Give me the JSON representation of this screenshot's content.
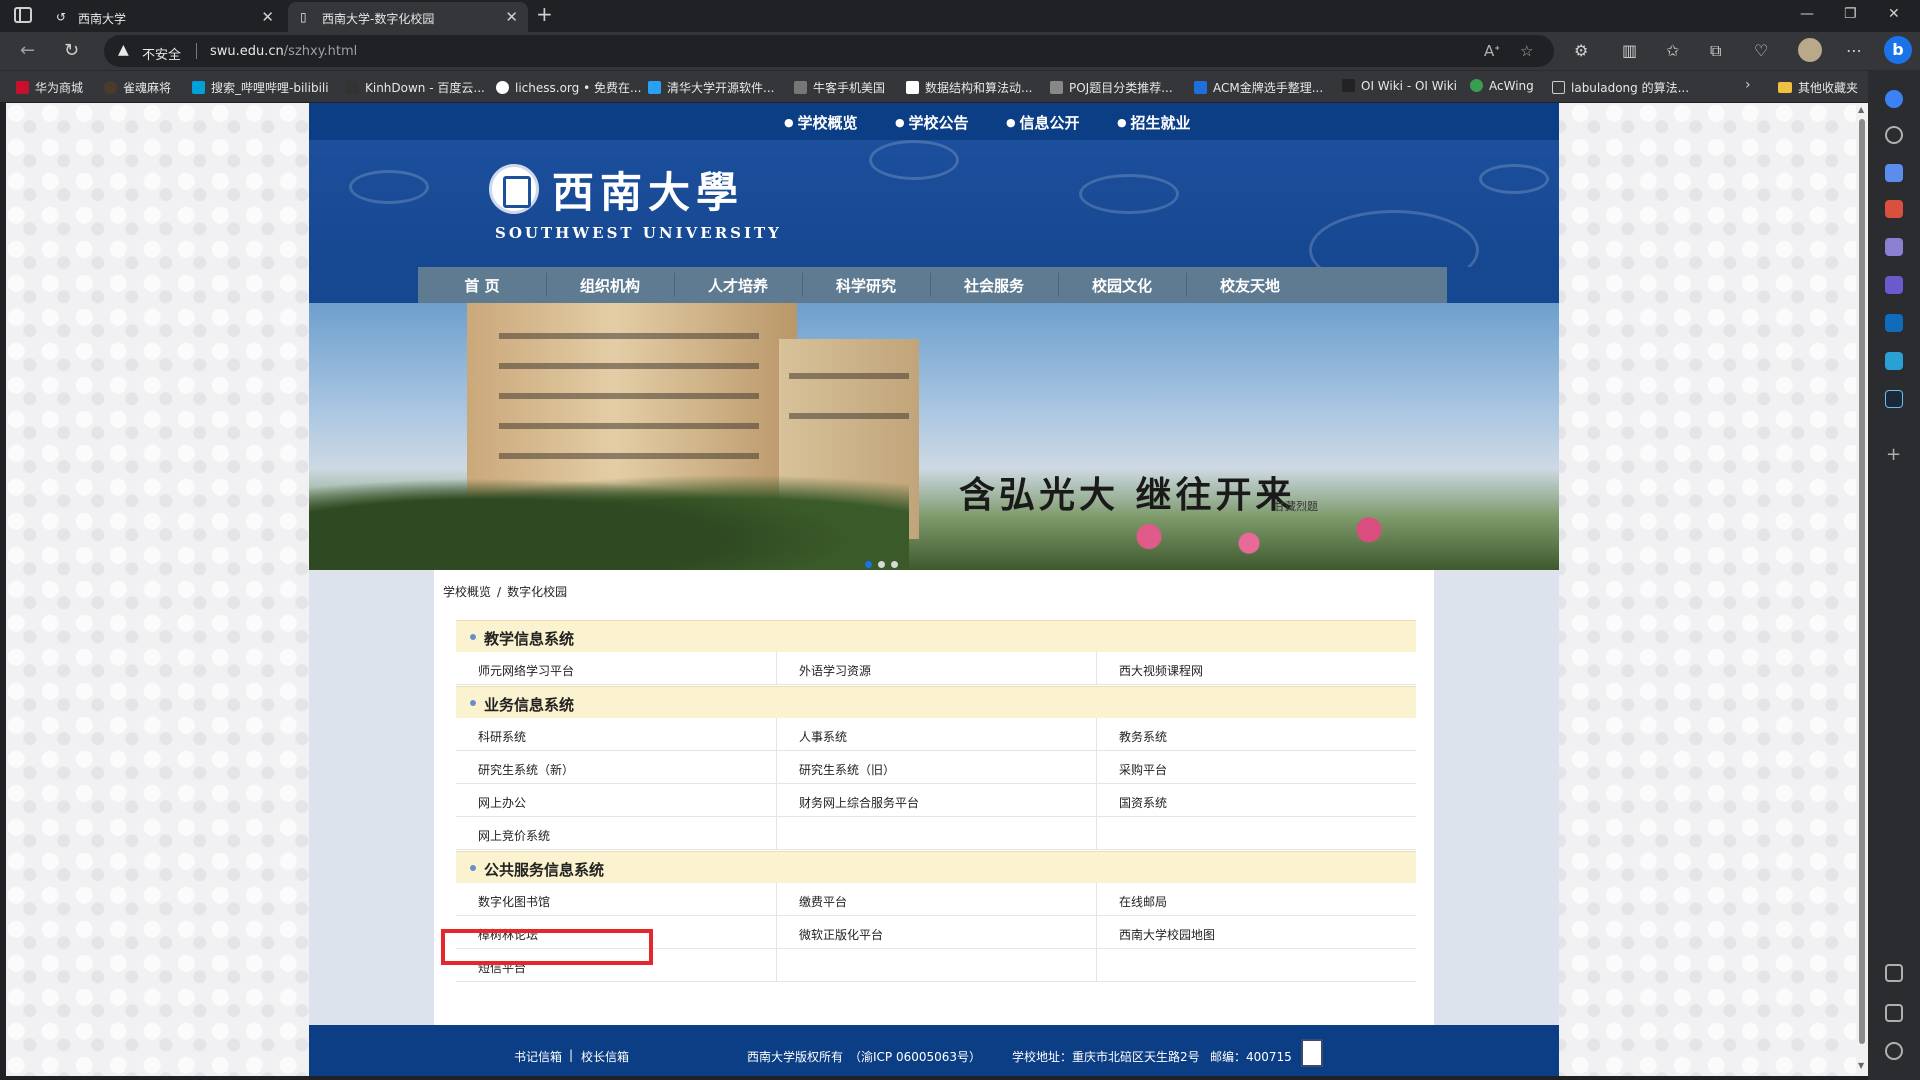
{
  "browser": {
    "tabs": [
      {
        "title": "西南大学",
        "active": false
      },
      {
        "title": "西南大学-数字化校园",
        "active": true
      }
    ],
    "address": {
      "security_label": "不安全",
      "domain": "swu.edu.cn",
      "path": "/szhxy.html"
    },
    "bookmarks": [
      {
        "label": "华为商城",
        "color": "#c8102e"
      },
      {
        "label": "雀魂麻将",
        "color": "#4a3b2a"
      },
      {
        "label": "搜索_哔哩哔哩-bilibili",
        "color": "#00a1d6"
      },
      {
        "label": "KinhDown - 百度云...",
        "color": "#333333"
      },
      {
        "label": "lichess.org • 免费在...",
        "color": "#ffffff"
      },
      {
        "label": "清华大学开源软件...",
        "color": "#2aa0f5"
      },
      {
        "label": "牛客手机美国",
        "color": "#777777"
      },
      {
        "label": "数据结构和算法动...",
        "color": "#ffffff"
      },
      {
        "label": "POJ题目分类推荐...",
        "color": "#888888"
      },
      {
        "label": "ACM金牌选手整理...",
        "color": "#1e6fd9"
      },
      {
        "label": "OI Wiki - OI Wiki",
        "color": "#222222"
      },
      {
        "label": "AcWing",
        "color": "#3a9e4f"
      },
      {
        "label": "labuladong 的算法...",
        "color": "#888888"
      }
    ],
    "bookmarks_other": "其他收藏夹"
  },
  "site": {
    "top_links": [
      "学校概览",
      "学校公告",
      "信息公开",
      "招生就业"
    ],
    "logo_cn": "西南大學",
    "logo_en": "SOUTHWEST UNIVERSITY",
    "nav": [
      "首 页",
      "组织机构",
      "人才培养",
      "科学研究",
      "社会服务",
      "校园文化",
      "校友天地"
    ],
    "motto": "含弘光大  继往开来",
    "motto_sign": "甘藏烈题",
    "breadcrumb": {
      "parent": "学校概览",
      "separator": "/",
      "current": "数字化校园"
    },
    "sections": [
      {
        "title": "教学信息系统",
        "rows": [
          [
            "师元网络学习平台",
            "外语学习资源",
            "西大视频课程网"
          ]
        ]
      },
      {
        "title": "业务信息系统",
        "rows": [
          [
            "科研系统",
            "人事系统",
            "教务系统"
          ],
          [
            "研究生系统（新）",
            "研究生系统（旧）",
            "采购平台"
          ],
          [
            "网上办公",
            "财务网上综合服务平台",
            "国资系统"
          ],
          [
            "网上竞价系统",
            "",
            ""
          ]
        ]
      },
      {
        "title": "公共服务信息系统",
        "rows": [
          [
            "数字化图书馆",
            "缴费平台",
            "在线邮局"
          ],
          [
            "樟树林论坛",
            "微软正版化平台",
            "西南大学校园地图"
          ],
          [
            "短信平台",
            "",
            ""
          ]
        ]
      }
    ],
    "footer": {
      "links": [
        "书记信箱",
        "校长信箱"
      ],
      "separator": "|",
      "copyright": "西南大学版权所有",
      "icp": "（渝ICP 06005063号）",
      "address": "学校地址：重庆市北碚区天生路2号",
      "postcode": "邮编：400715"
    }
  },
  "colors": {
    "site_blue": "#0c3e86",
    "nav_gray": "#5f7b92",
    "section_bg": "#fbf3cf",
    "highlight": "#e5262c"
  }
}
